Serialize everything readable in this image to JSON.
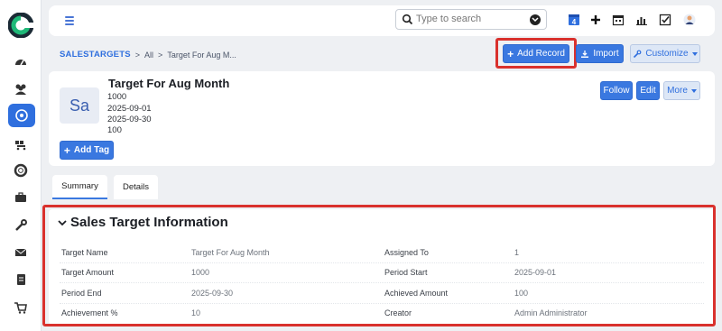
{
  "topbar": {
    "search_placeholder": "Type to search",
    "calendar_badge": "4"
  },
  "sidebar": {
    "items": [
      "dashboard-icon",
      "users-icon",
      "target-icon",
      "sales-icon",
      "support-icon",
      "briefcase-icon",
      "tools-icon",
      "email-icon",
      "document-icon",
      "cart-icon"
    ],
    "active": "target-icon"
  },
  "breadcrumb": {
    "root": "SALESTARGETS",
    "sep1": ">",
    "all": "All",
    "sep2": ">",
    "current": "Target For Aug M..."
  },
  "actions": {
    "add_record": "Add Record",
    "import": "Import",
    "customize": "Customize"
  },
  "record": {
    "avatar": "Sa",
    "title": "Target For Aug Month",
    "lines": [
      "1000",
      "2025-09-01",
      "2025-09-30",
      "100"
    ],
    "add_tag": "Add Tag",
    "follow": "Follow",
    "edit": "Edit",
    "more": "More"
  },
  "tabs": {
    "summary": "Summary",
    "details": "Details"
  },
  "panel": {
    "title": "Sales Target Information",
    "fields": [
      {
        "label": "Target Name",
        "value": "Target For Aug Month"
      },
      {
        "label": "Assigned To",
        "value": "1"
      },
      {
        "label": "Target Amount",
        "value": "1000"
      },
      {
        "label": "Period Start",
        "value": "2025-09-01"
      },
      {
        "label": "Period End",
        "value": "2025-09-30"
      },
      {
        "label": "Achieved Amount",
        "value": "100"
      },
      {
        "label": "Achievement %",
        "value": "10"
      },
      {
        "label": "Creator",
        "value": "Admin Administrator"
      }
    ]
  },
  "colors": {
    "primary": "#3a78e0",
    "highlight": "#d9312d",
    "logo_green": "#1fb978"
  }
}
